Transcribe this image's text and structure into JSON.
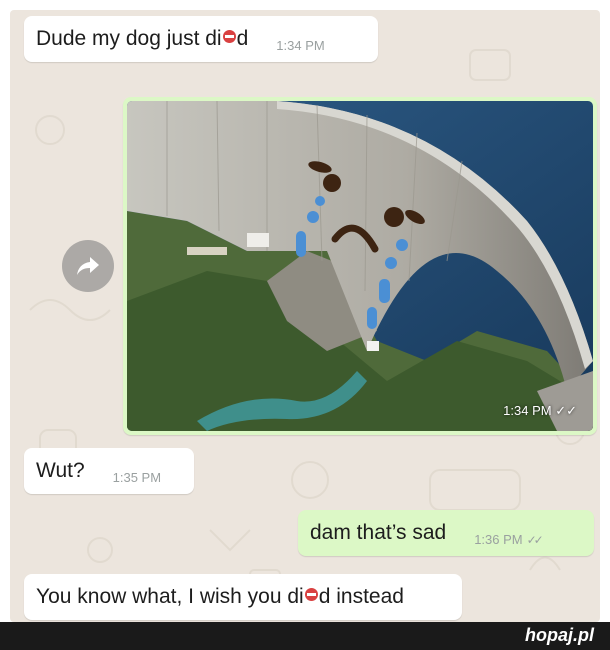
{
  "messages": [
    {
      "text_before": "Dude my dog just di",
      "text_after": "d",
      "time": "1:34 PM"
    },
    {
      "time": "1:34 PM",
      "ticks": "✓✓"
    },
    {
      "text": "Wut?",
      "time": "1:35 PM"
    },
    {
      "text": "dam that’s sad",
      "time": "1:36 PM",
      "ticks": "✓✓"
    },
    {
      "text_before": "You know what, I wish you di",
      "text_after": "d instead"
    }
  ],
  "icons": {
    "forward": "forward-arrow-icon",
    "censor": "censor-emoji-icon"
  },
  "colors": {
    "chat_bg": "#ece5dd",
    "incoming": "#ffffff",
    "outgoing": "#dcf8c6",
    "footer": "#1a1a1a"
  },
  "footer": {
    "brand": "hopaj.pl"
  }
}
